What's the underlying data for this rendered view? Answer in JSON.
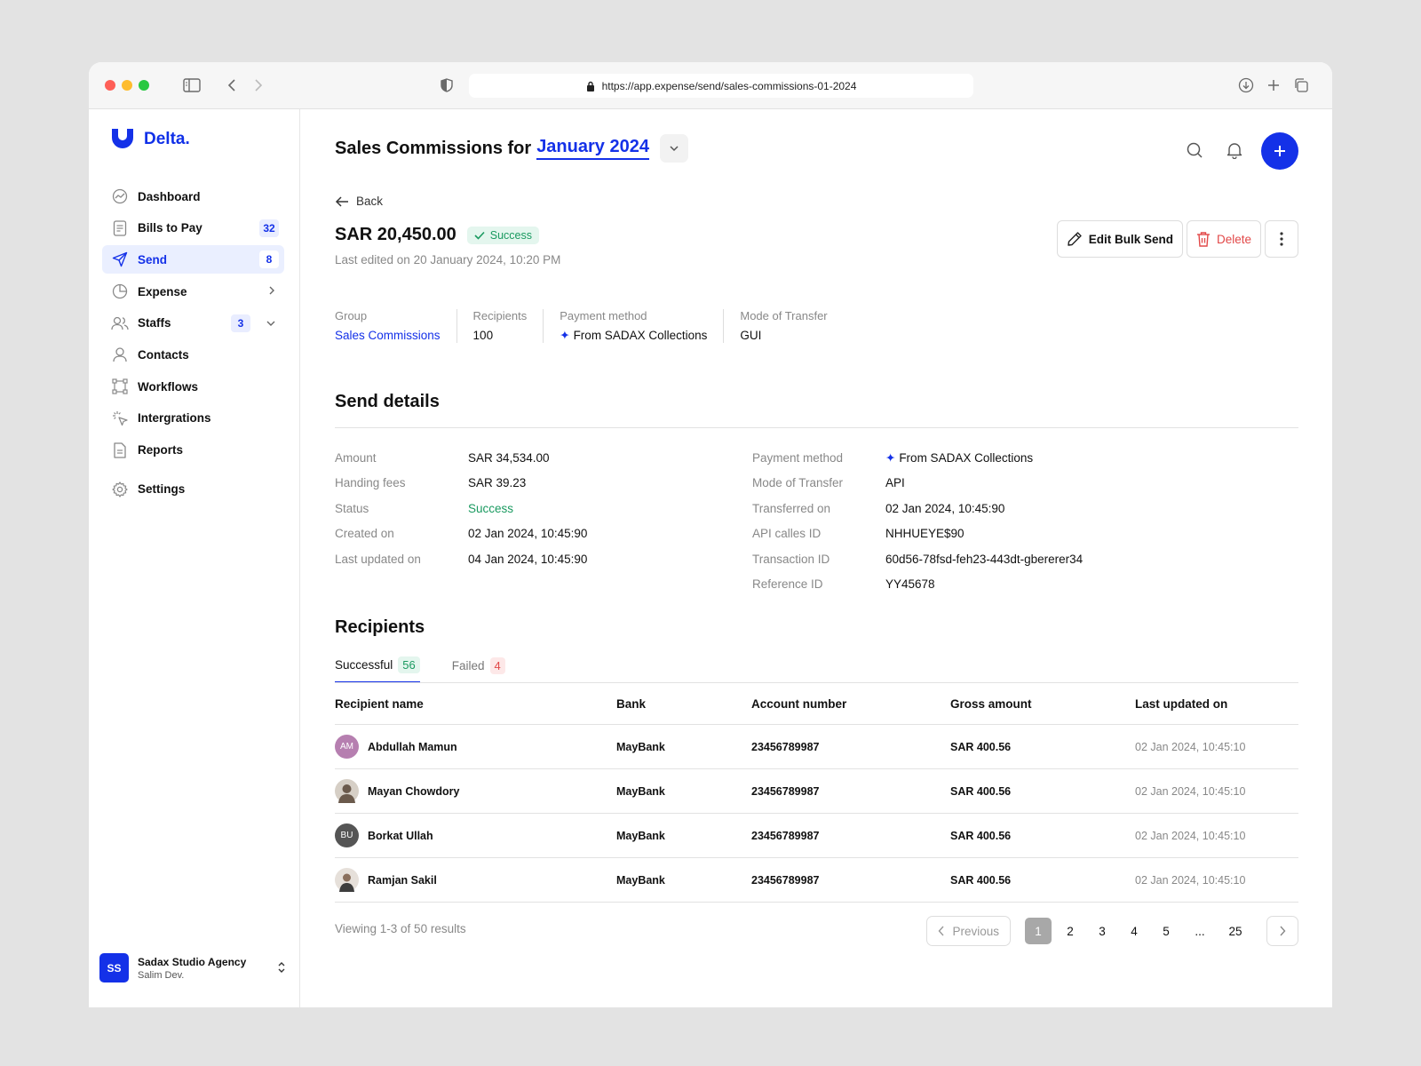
{
  "browser": {
    "url": "https://app.expense/send/sales-commissions-01-2024"
  },
  "brand": {
    "name": "Delta.",
    "color": "#1431e8"
  },
  "sidebar": {
    "items": [
      {
        "label": "Dashboard",
        "icon": "dashboard-icon"
      },
      {
        "label": "Bills to Pay",
        "badge": "32",
        "icon": "bill-icon"
      },
      {
        "label": "Send",
        "badge": "8",
        "icon": "send-icon",
        "active": true
      },
      {
        "label": "Expense",
        "icon": "pie-chart-icon"
      },
      {
        "label": "Staffs",
        "badge": "3",
        "icon": "users-icon"
      },
      {
        "label": "Contacts",
        "icon": "user-icon"
      },
      {
        "label": "Workflows",
        "icon": "workflow-icon"
      },
      {
        "label": "Intergrations",
        "icon": "integrations-icon"
      },
      {
        "label": "Reports",
        "icon": "report-icon"
      }
    ],
    "settings": "Settings",
    "user": {
      "initials": "SS",
      "org": "Sadax Studio Agency",
      "role": "Salim Dev."
    }
  },
  "header": {
    "title_prefix": "Sales Commissions for",
    "period": "January 2024"
  },
  "back_label": "Back",
  "summary": {
    "amount": "SAR 20,450.00",
    "status": "Success",
    "edited": "Last edited on 20 January 2024, 10:20 PM",
    "edit_label": "Edit Bulk Send",
    "delete_label": "Delete"
  },
  "meta": {
    "group_label": "Group",
    "group_value": "Sales Commissions",
    "recipients_label": "Recipients",
    "recipients_value": "100",
    "payment_label": "Payment method",
    "payment_value": "From SADAX Collections",
    "mode_label": "Mode of Transfer",
    "mode_value": "GUI"
  },
  "send_details": {
    "title": "Send details",
    "left": [
      {
        "label": "Amount",
        "value": "SAR 34,534.00"
      },
      {
        "label": "Handing fees",
        "value": "SAR 39.23"
      },
      {
        "label": "Status",
        "value": "Success"
      },
      {
        "label": "Created on",
        "value": "02 Jan 2024, 10:45:90"
      },
      {
        "label": "Last updated on",
        "value": "04 Jan 2024, 10:45:90"
      }
    ],
    "right": [
      {
        "label": "Payment method",
        "value": "From SADAX Collections"
      },
      {
        "label": "Mode of Transfer",
        "value": "API"
      },
      {
        "label": "Transferred on",
        "value": "02 Jan 2024, 10:45:90"
      },
      {
        "label": "API calles ID",
        "value": "NHHUEYE$90"
      },
      {
        "label": "Transaction ID",
        "value": "60d56-78fsd-feh23-443dt-gbererer34"
      },
      {
        "label": "Reference ID",
        "value": "YY45678"
      }
    ]
  },
  "recipients": {
    "title": "Recipients",
    "tabs": [
      {
        "label": "Successful",
        "count": "56"
      },
      {
        "label": "Failed",
        "count": "4"
      }
    ],
    "columns": [
      "Recipient name",
      "Bank",
      "Account number",
      "Gross amount",
      "Last updated on"
    ],
    "rows": [
      {
        "initials": "AM",
        "avatar_color": "#b67fb0",
        "name": "Abdullah Mamun",
        "bank": "MayBank",
        "account": "23456789987",
        "amount": "SAR 400.56",
        "updated": "02 Jan 2024, 10:45:10"
      },
      {
        "initials": "",
        "avatar_color": "#6b5a4c",
        "name": "Mayan Chowdory",
        "bank": "MayBank",
        "account": "23456789987",
        "amount": "SAR 400.56",
        "updated": "02 Jan 2024, 10:45:10"
      },
      {
        "initials": "BU",
        "avatar_color": "#555555",
        "name": "Borkat Ullah",
        "bank": "MayBank",
        "account": "23456789987",
        "amount": "SAR 400.56",
        "updated": "02 Jan 2024, 10:45:10"
      },
      {
        "initials": "",
        "avatar_color": "#d9cfc8",
        "name": "Ramjan Sakil",
        "bank": "MayBank",
        "account": "23456789987",
        "amount": "SAR 400.56",
        "updated": "02 Jan 2024, 10:45:10"
      }
    ],
    "viewing": "Viewing 1-3 of 50 results",
    "pagination": {
      "previous": "Previous",
      "pages": [
        "1",
        "2",
        "3",
        "4",
        "5",
        "...",
        "25"
      ],
      "current": "1"
    }
  }
}
